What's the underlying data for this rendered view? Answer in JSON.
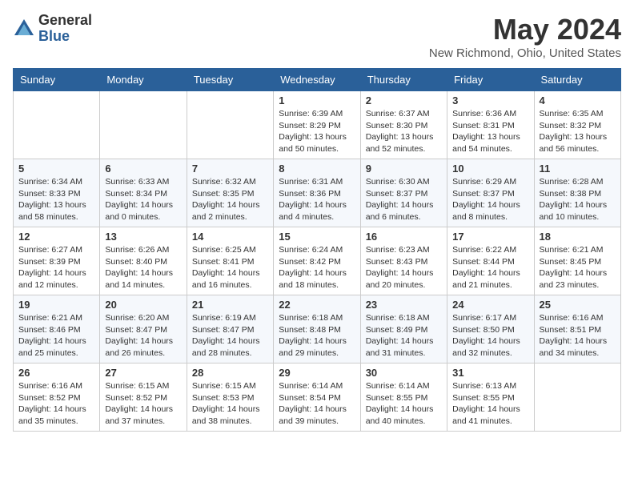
{
  "header": {
    "logo_general": "General",
    "logo_blue": "Blue",
    "title": "May 2024",
    "location": "New Richmond, Ohio, United States"
  },
  "days_of_week": [
    "Sunday",
    "Monday",
    "Tuesday",
    "Wednesday",
    "Thursday",
    "Friday",
    "Saturday"
  ],
  "weeks": [
    [
      {
        "day": "",
        "info": ""
      },
      {
        "day": "",
        "info": ""
      },
      {
        "day": "",
        "info": ""
      },
      {
        "day": "1",
        "sunrise": "Sunrise: 6:39 AM",
        "sunset": "Sunset: 8:29 PM",
        "daylight": "Daylight: 13 hours and 50 minutes."
      },
      {
        "day": "2",
        "sunrise": "Sunrise: 6:37 AM",
        "sunset": "Sunset: 8:30 PM",
        "daylight": "Daylight: 13 hours and 52 minutes."
      },
      {
        "day": "3",
        "sunrise": "Sunrise: 6:36 AM",
        "sunset": "Sunset: 8:31 PM",
        "daylight": "Daylight: 13 hours and 54 minutes."
      },
      {
        "day": "4",
        "sunrise": "Sunrise: 6:35 AM",
        "sunset": "Sunset: 8:32 PM",
        "daylight": "Daylight: 13 hours and 56 minutes."
      }
    ],
    [
      {
        "day": "5",
        "sunrise": "Sunrise: 6:34 AM",
        "sunset": "Sunset: 8:33 PM",
        "daylight": "Daylight: 13 hours and 58 minutes."
      },
      {
        "day": "6",
        "sunrise": "Sunrise: 6:33 AM",
        "sunset": "Sunset: 8:34 PM",
        "daylight": "Daylight: 14 hours and 0 minutes."
      },
      {
        "day": "7",
        "sunrise": "Sunrise: 6:32 AM",
        "sunset": "Sunset: 8:35 PM",
        "daylight": "Daylight: 14 hours and 2 minutes."
      },
      {
        "day": "8",
        "sunrise": "Sunrise: 6:31 AM",
        "sunset": "Sunset: 8:36 PM",
        "daylight": "Daylight: 14 hours and 4 minutes."
      },
      {
        "day": "9",
        "sunrise": "Sunrise: 6:30 AM",
        "sunset": "Sunset: 8:37 PM",
        "daylight": "Daylight: 14 hours and 6 minutes."
      },
      {
        "day": "10",
        "sunrise": "Sunrise: 6:29 AM",
        "sunset": "Sunset: 8:37 PM",
        "daylight": "Daylight: 14 hours and 8 minutes."
      },
      {
        "day": "11",
        "sunrise": "Sunrise: 6:28 AM",
        "sunset": "Sunset: 8:38 PM",
        "daylight": "Daylight: 14 hours and 10 minutes."
      }
    ],
    [
      {
        "day": "12",
        "sunrise": "Sunrise: 6:27 AM",
        "sunset": "Sunset: 8:39 PM",
        "daylight": "Daylight: 14 hours and 12 minutes."
      },
      {
        "day": "13",
        "sunrise": "Sunrise: 6:26 AM",
        "sunset": "Sunset: 8:40 PM",
        "daylight": "Daylight: 14 hours and 14 minutes."
      },
      {
        "day": "14",
        "sunrise": "Sunrise: 6:25 AM",
        "sunset": "Sunset: 8:41 PM",
        "daylight": "Daylight: 14 hours and 16 minutes."
      },
      {
        "day": "15",
        "sunrise": "Sunrise: 6:24 AM",
        "sunset": "Sunset: 8:42 PM",
        "daylight": "Daylight: 14 hours and 18 minutes."
      },
      {
        "day": "16",
        "sunrise": "Sunrise: 6:23 AM",
        "sunset": "Sunset: 8:43 PM",
        "daylight": "Daylight: 14 hours and 20 minutes."
      },
      {
        "day": "17",
        "sunrise": "Sunrise: 6:22 AM",
        "sunset": "Sunset: 8:44 PM",
        "daylight": "Daylight: 14 hours and 21 minutes."
      },
      {
        "day": "18",
        "sunrise": "Sunrise: 6:21 AM",
        "sunset": "Sunset: 8:45 PM",
        "daylight": "Daylight: 14 hours and 23 minutes."
      }
    ],
    [
      {
        "day": "19",
        "sunrise": "Sunrise: 6:21 AM",
        "sunset": "Sunset: 8:46 PM",
        "daylight": "Daylight: 14 hours and 25 minutes."
      },
      {
        "day": "20",
        "sunrise": "Sunrise: 6:20 AM",
        "sunset": "Sunset: 8:47 PM",
        "daylight": "Daylight: 14 hours and 26 minutes."
      },
      {
        "day": "21",
        "sunrise": "Sunrise: 6:19 AM",
        "sunset": "Sunset: 8:47 PM",
        "daylight": "Daylight: 14 hours and 28 minutes."
      },
      {
        "day": "22",
        "sunrise": "Sunrise: 6:18 AM",
        "sunset": "Sunset: 8:48 PM",
        "daylight": "Daylight: 14 hours and 29 minutes."
      },
      {
        "day": "23",
        "sunrise": "Sunrise: 6:18 AM",
        "sunset": "Sunset: 8:49 PM",
        "daylight": "Daylight: 14 hours and 31 minutes."
      },
      {
        "day": "24",
        "sunrise": "Sunrise: 6:17 AM",
        "sunset": "Sunset: 8:50 PM",
        "daylight": "Daylight: 14 hours and 32 minutes."
      },
      {
        "day": "25",
        "sunrise": "Sunrise: 6:16 AM",
        "sunset": "Sunset: 8:51 PM",
        "daylight": "Daylight: 14 hours and 34 minutes."
      }
    ],
    [
      {
        "day": "26",
        "sunrise": "Sunrise: 6:16 AM",
        "sunset": "Sunset: 8:52 PM",
        "daylight": "Daylight: 14 hours and 35 minutes."
      },
      {
        "day": "27",
        "sunrise": "Sunrise: 6:15 AM",
        "sunset": "Sunset: 8:52 PM",
        "daylight": "Daylight: 14 hours and 37 minutes."
      },
      {
        "day": "28",
        "sunrise": "Sunrise: 6:15 AM",
        "sunset": "Sunset: 8:53 PM",
        "daylight": "Daylight: 14 hours and 38 minutes."
      },
      {
        "day": "29",
        "sunrise": "Sunrise: 6:14 AM",
        "sunset": "Sunset: 8:54 PM",
        "daylight": "Daylight: 14 hours and 39 minutes."
      },
      {
        "day": "30",
        "sunrise": "Sunrise: 6:14 AM",
        "sunset": "Sunset: 8:55 PM",
        "daylight": "Daylight: 14 hours and 40 minutes."
      },
      {
        "day": "31",
        "sunrise": "Sunrise: 6:13 AM",
        "sunset": "Sunset: 8:55 PM",
        "daylight": "Daylight: 14 hours and 41 minutes."
      },
      {
        "day": "",
        "info": ""
      }
    ]
  ]
}
